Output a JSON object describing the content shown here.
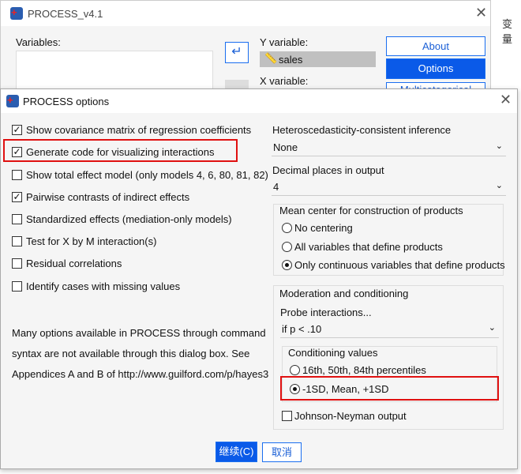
{
  "background_window": {
    "title": "PROCESS_v4.1",
    "variables_label": "Variables:",
    "y_variable_label": "Y variable:",
    "y_variable_value": "sales",
    "x_variable_label": "X variable:",
    "buttons": {
      "about": "About",
      "options": "Options",
      "multicategorical": "Multicategorical"
    },
    "side_text": "变量"
  },
  "dialog": {
    "title": "PROCESS options",
    "checkboxes": [
      {
        "label": "Show covariance matrix of regression coefficients",
        "checked": true
      },
      {
        "label": "Generate code for visualizing interactions",
        "checked": true
      },
      {
        "label": "Show total effect model (only models 4, 6, 80, 81, 82)",
        "checked": false
      },
      {
        "label": "Pairwise contrasts of indirect effects",
        "checked": true
      },
      {
        "label": "Standardized effects (mediation-only models)",
        "checked": false
      },
      {
        "label": "Test for X by M interaction(s)",
        "checked": false
      },
      {
        "label": "Residual correlations",
        "checked": false
      },
      {
        "label": "Identify cases with missing values",
        "checked": false
      }
    ],
    "note_lines": [
      "Many options available in PROCESS through command",
      "syntax are not available through this dialog box.  See",
      "Appendices A and B of http://www.guilford.com/p/hayes3"
    ],
    "hc_label": "Heteroscedasticity-consistent inference",
    "hc_value": "None",
    "decimal_label": "Decimal places in output",
    "decimal_value": "4",
    "mean_center": {
      "title": "Mean center for construction of products",
      "options": [
        "No centering",
        "All variables that define products",
        "Only continuous variables that define products"
      ],
      "selected": 2
    },
    "moderation": {
      "title": "Moderation and conditioning",
      "probe_label": "Probe interactions...",
      "probe_value": "if p < .10",
      "conditioning": {
        "title": "Conditioning values",
        "options": [
          "16th, 50th, 84th percentiles",
          "-1SD, Mean, +1SD"
        ],
        "selected": 1
      },
      "jn_label": "Johnson-Neyman output",
      "jn_checked": false
    },
    "continue_label": "继续(C)",
    "cancel_label": "取消"
  },
  "colors": {
    "accent": "#0a5ae8",
    "highlight": "#e01010"
  }
}
